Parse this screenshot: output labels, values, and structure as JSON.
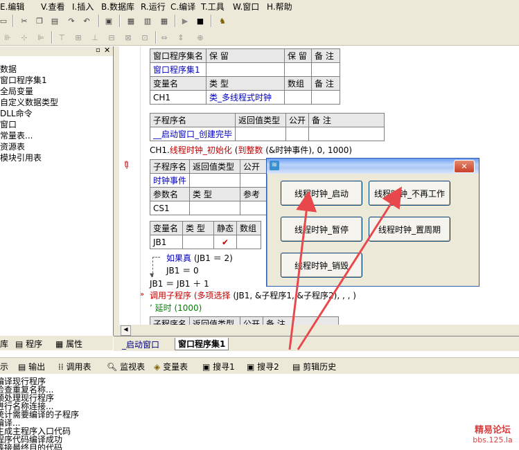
{
  "menu": [
    "E.编辑",
    "V.查看",
    "I.插入",
    "B.数据库",
    "R.运行",
    "C.编译",
    "T.工具",
    "W.窗口",
    "H.帮助"
  ],
  "tree": [
    "数据",
    "窗口程序集1",
    "全局变量",
    "自定义数据类型",
    "DLL命令",
    "窗口",
    "常量表...",
    "资源表",
    "模块引用表"
  ],
  "left_tabs": [
    "库",
    "程序",
    "属性"
  ],
  "table1": {
    "headers": [
      "窗口程序集名",
      "保 留",
      "保 留",
      "备 注"
    ],
    "row": [
      "窗口程序集1",
      "",
      "",
      ""
    ],
    "var_headers": [
      "变量名",
      "类 型",
      "数组",
      "备 注"
    ],
    "var_row": [
      "CH1",
      "类_多线程式时钟",
      "",
      ""
    ]
  },
  "table2": {
    "headers": [
      "子程序名",
      "返回值类型",
      "公开",
      "备 注"
    ],
    "row": [
      "__启动窗口_创建完毕",
      "",
      "",
      ""
    ]
  },
  "code1": {
    "obj": "CH1.",
    "method": "线程时钟_初始化",
    "paren1": " (",
    "func": "到整数",
    "args": " (&时钟事件), 0, 1000)"
  },
  "table3": {
    "headers": [
      "子程序名",
      "返回值类型",
      "公开"
    ],
    "row": [
      "时钟事件",
      "",
      ""
    ],
    "param_headers": [
      "参数名",
      "类 型",
      "参考"
    ],
    "param_row": [
      "CS1",
      "",
      ""
    ]
  },
  "table4": {
    "headers": [
      "变量名",
      "类 型",
      "静态",
      "数组"
    ],
    "row": [
      "JB1",
      "",
      "✔",
      ""
    ]
  },
  "code2": {
    "if_kw": "如果真",
    "if_cond": " (JB1 ＝ 2)",
    "assign1": "JB1 ＝ 0",
    "assign2": "JB1 ＝ JB1 ＋ 1",
    "call_kw": "调用子程序",
    "call_func": " (多项选择",
    "call_args": " (JB1, &子程序1, &子程序2), , , )",
    "delay": "’ 延时 (1000)"
  },
  "table5": {
    "headers": [
      "子程序名",
      "返回值类型",
      "公开",
      "备 注"
    ]
  },
  "dialog": {
    "buttons": [
      "线程时钟_启动",
      "线程时钟_不再工作",
      "线程时钟_暂停",
      "线程时钟_置周期",
      "线程时钟_销毁"
    ]
  },
  "editor_tabs": [
    "_启动窗口",
    "窗口程序集1"
  ],
  "bottom_tabs": [
    "示",
    "输出",
    "调用表",
    "监视表",
    "变量表",
    "搜寻1",
    "搜寻2",
    "剪辑历史"
  ],
  "output_lines": [
    "编译现行程序",
    "检查重复名称...",
    "预处理现行程序",
    "进行名称连接...",
    "统计需要编译的子程序",
    "编译...",
    "生成主程序入口代码",
    "程序代码编译成功",
    "等接最终目的代码"
  ],
  "watermark": {
    "line1": "精易论坛",
    "line2": "bbs.125.la"
  }
}
